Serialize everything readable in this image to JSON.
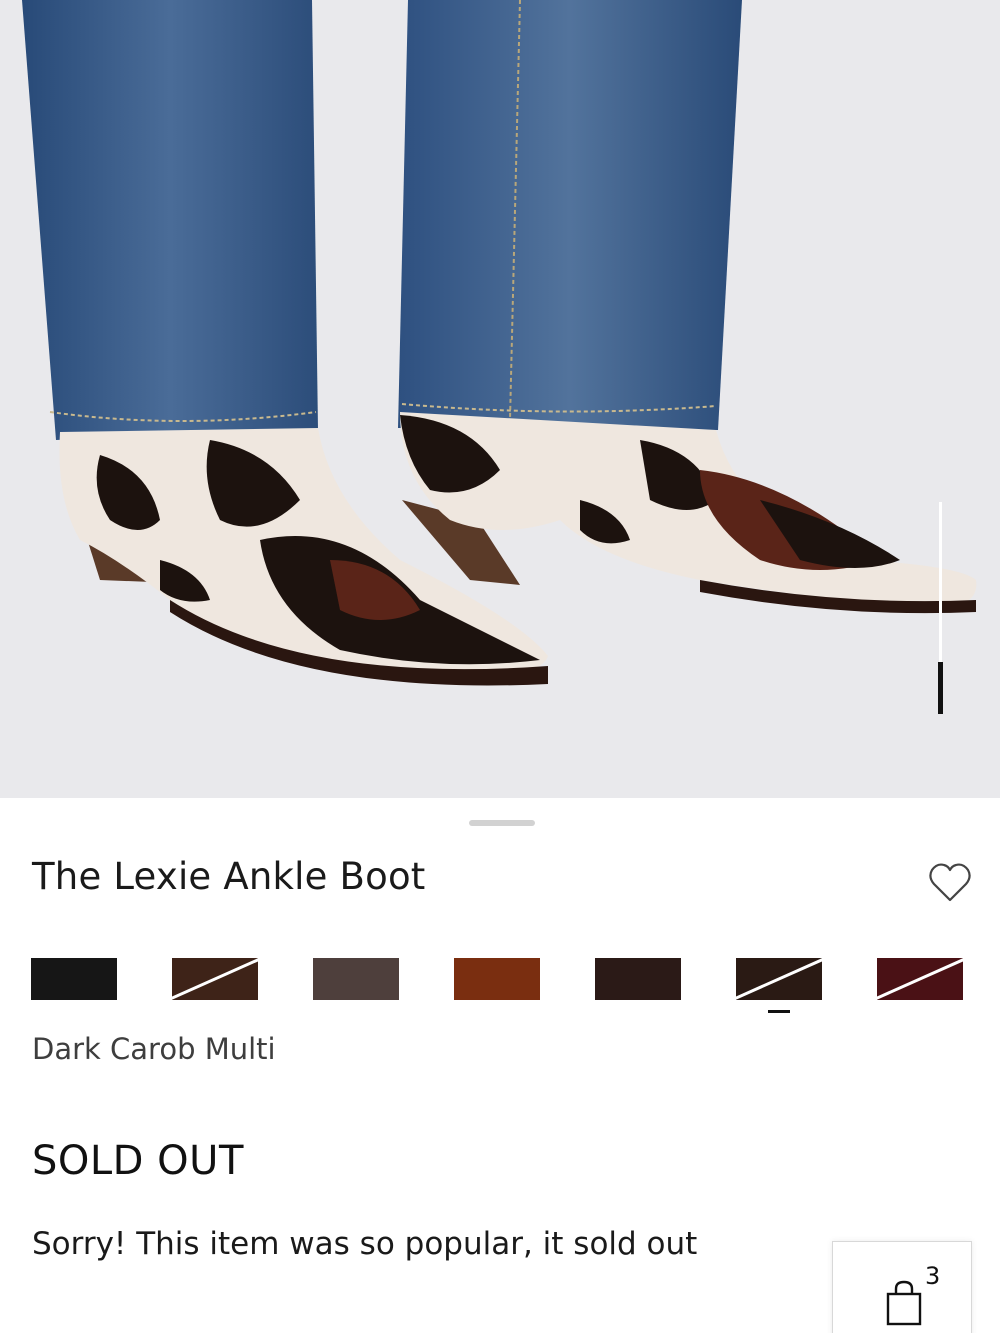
{
  "product": {
    "title": "The Lexie Ankle Boot",
    "selected_color": "Dark Carob Multi",
    "status": "SOLD OUT",
    "status_message": "Sorry! This item was so popular, it sold out"
  },
  "swatches": [
    {
      "name": "black",
      "color": "#161616",
      "unavailable": false
    },
    {
      "name": "dark-brown",
      "color": "#3e2318",
      "unavailable": true
    },
    {
      "name": "taupe-brown",
      "color": "#4e3f3c",
      "unavailable": false
    },
    {
      "name": "cognac",
      "color": "#7a2e10",
      "unavailable": false
    },
    {
      "name": "croc-dark",
      "color": "#2b1a17",
      "unavailable": false
    },
    {
      "name": "dark-carob-multi",
      "color": "#2a1a14",
      "unavailable": true,
      "selected": true
    },
    {
      "name": "burgundy",
      "color": "#4a1115",
      "unavailable": true
    }
  ],
  "cart": {
    "count": "3"
  },
  "icons": {
    "favorite": "heart-icon",
    "cart": "shopping-bag-icon"
  },
  "colors": {
    "image_bg": "#e9e9ec",
    "denim": "#3a5a86",
    "hide_cream": "#efe7df",
    "hide_dark": "#1c120e"
  }
}
